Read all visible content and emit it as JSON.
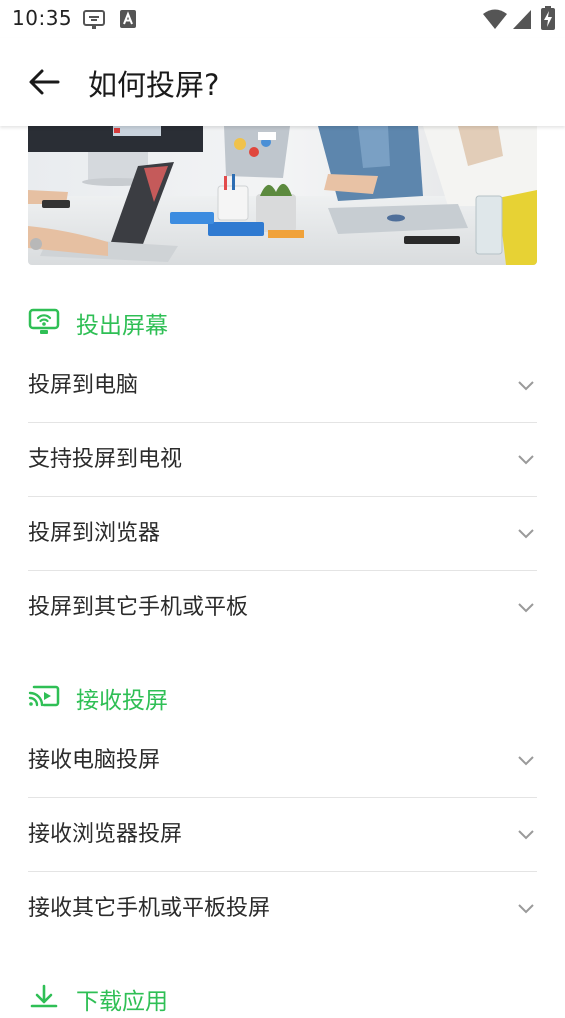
{
  "status_bar": {
    "time": "10:35"
  },
  "header": {
    "title": "如何投屏?",
    "back_icon": "arrow-left-icon"
  },
  "colors": {
    "accent": "#2fbf55",
    "text": "#2b2b2b",
    "divider": "#e4e4e4"
  },
  "sections": [
    {
      "title": "投出屏幕",
      "icon": "cast-screen-icon",
      "items": [
        "投屏到电脑",
        "支持投屏到电视",
        "投屏到浏览器",
        "投屏到其它手机或平板"
      ]
    },
    {
      "title": "接收投屏",
      "icon": "receive-cast-icon",
      "items": [
        "接收电脑投屏",
        "接收浏览器投屏",
        "接收其它手机或平板投屏"
      ]
    },
    {
      "title": "下载应用",
      "icon": "download-icon",
      "items": []
    }
  ]
}
